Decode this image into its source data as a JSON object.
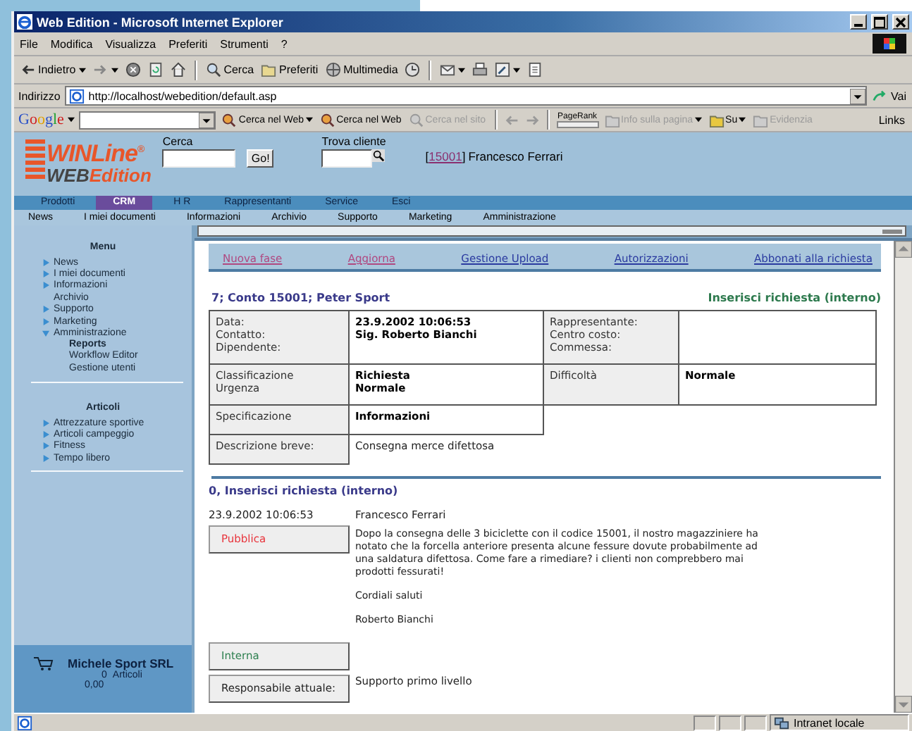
{
  "window": {
    "title": "Web Edition - Microsoft Internet Explorer"
  },
  "menu_bar": [
    "File",
    "Modifica",
    "Visualizza",
    "Preferiti",
    "Strumenti",
    "?"
  ],
  "toolbar": [
    {
      "kind": "button",
      "label": "Indietro",
      "caret": true
    },
    {
      "kind": "button",
      "caret": true
    },
    {
      "kind": "button"
    },
    {
      "kind": "button"
    },
    {
      "kind": "button"
    },
    {
      "kind": "separator"
    },
    {
      "kind": "button",
      "label": "Cerca"
    },
    {
      "kind": "button",
      "label": "Preferiti"
    },
    {
      "kind": "button",
      "label": "Multimedia"
    },
    {
      "kind": "button"
    },
    {
      "kind": "separator"
    },
    {
      "kind": "button",
      "caret": true
    },
    {
      "kind": "button"
    },
    {
      "kind": "button",
      "caret": true
    },
    {
      "kind": "button"
    }
  ],
  "address_bar": {
    "label": "Indirizzo",
    "value": "http://localhost/webedition/default.asp",
    "go": "Vai"
  },
  "google_bar": {
    "logo": "Google",
    "items": [
      {
        "label": "Cerca nel Web",
        "caret": true,
        "disabled": false
      },
      {
        "label": "Cerca nel Web",
        "caret": false,
        "disabled": false
      },
      {
        "label": "Cerca nel sito",
        "caret": false,
        "disabled": true
      }
    ],
    "pagerank": "PageRank",
    "items2": [
      {
        "label": "Info sulla pagina",
        "caret": true,
        "disabled": true
      },
      {
        "label": "Su",
        "caret": true,
        "disabled": false
      },
      {
        "label": "Evidenzia",
        "caret": false,
        "disabled": true
      }
    ],
    "links": "Links"
  },
  "header": {
    "logo_top": "WINLine",
    "logo_mark": "®",
    "logo_bottom_a": "WEB",
    "logo_bottom_b": "Edition",
    "search_label": "Cerca",
    "go": "Go!",
    "find_label": "Trova cliente",
    "customer_open": "[",
    "customer_code": "15001",
    "customer_close": "]",
    "customer_name": "Francesco Ferrari"
  },
  "nav_tabs": [
    {
      "label": "Prodotti",
      "selected": false
    },
    {
      "label": "CRM",
      "selected": true
    },
    {
      "label": "H R",
      "selected": false
    },
    {
      "label": "Rappresentanti",
      "selected": false
    },
    {
      "label": "Service",
      "selected": false
    },
    {
      "label": "Esci",
      "selected": false
    }
  ],
  "sub_nav": [
    "News",
    "I miei documenti",
    "Informazioni",
    "Archivio",
    "Supporto",
    "Marketing",
    "Amministrazione"
  ],
  "sidebar": {
    "menu_title": "Menu",
    "menu": [
      {
        "label": "News",
        "kind": "arrow",
        "expanded": false
      },
      {
        "label": "I miei documenti",
        "kind": "arrow",
        "expanded": false
      },
      {
        "label": "Informazioni",
        "kind": "arrow",
        "expanded": false
      },
      {
        "label": "Archivio",
        "kind": "plain"
      },
      {
        "label": "Supporto",
        "kind": "arrow",
        "expanded": false
      },
      {
        "label": "Marketing",
        "kind": "arrow",
        "expanded": false
      },
      {
        "label": "Amministrazione",
        "kind": "arrow",
        "expanded": true,
        "children": [
          {
            "label": "Reports",
            "selected": true
          },
          {
            "label": "Workflow Editor",
            "selected": false
          },
          {
            "label": "Gestione utenti",
            "selected": false
          }
        ]
      }
    ],
    "articles_title": "Articoli",
    "articles": [
      {
        "label": "Attrezzature sportive",
        "kind": "arrow",
        "expanded": false
      },
      {
        "label": "Articoli campeggio",
        "kind": "arrow",
        "expanded": false
      },
      {
        "label": "Fitness",
        "kind": "arrow",
        "expanded": false
      },
      {
        "label": "Tempo libero",
        "kind": "arrow",
        "expanded": false
      }
    ],
    "cart": {
      "company": "Michele Sport SRL",
      "count": "0",
      "count_label": "Articoli",
      "total": "0,00"
    }
  },
  "content": {
    "actions": [
      {
        "label": "Nuova fase",
        "visited": true
      },
      {
        "label": "Aggiorna",
        "visited": true
      },
      {
        "label": "Gestione Upload",
        "visited": false
      },
      {
        "label": "Autorizzazioni",
        "visited": false
      },
      {
        "label": "Abbonati alla richiesta",
        "visited": false
      }
    ],
    "heading": "7; Conto 15001; Peter Sport",
    "heading_right": "Inserisci richiesta (interno)",
    "details": [
      {
        "cells": [
          {
            "kind": "label",
            "lines": [
              "Data:",
              "Contatto:",
              "Dipendente:"
            ]
          },
          {
            "kind": "value",
            "lines": [
              "23.9.2002 10:06:53",
              "Sig. Roberto Bianchi"
            ]
          },
          {
            "kind": "label",
            "lines": [
              "Rappresentante:",
              "Centro costo:",
              "Commessa:"
            ]
          },
          {
            "kind": "value"
          }
        ]
      },
      {
        "cells": [
          {
            "kind": "label",
            "lines": [
              "Classificazione",
              "Urgenza"
            ]
          },
          {
            "kind": "value",
            "lines": [
              "Richiesta",
              "Normale"
            ]
          },
          {
            "kind": "label",
            "lines": [
              "Difficoltà"
            ]
          },
          {
            "kind": "value",
            "lines": [
              "Normale"
            ]
          }
        ]
      },
      {
        "cells": [
          {
            "kind": "label",
            "lines": [
              "Specificazione"
            ]
          },
          {
            "kind": "value",
            "lines": [
              "Informazioni"
            ]
          }
        ]
      },
      {
        "cells": [
          {
            "kind": "label",
            "lines": [
              "Descrizione breve:"
            ]
          },
          {
            "kind": "plain",
            "lines": [
              "Consegna merce difettosa"
            ]
          }
        ]
      }
    ],
    "entry_heading": "0, Inserisci richiesta (interno)",
    "entry": [
      {
        "kind": "meta",
        "date": "23.9.2002 10:06:53",
        "author": "Francesco Ferrari"
      },
      {
        "kind": "section",
        "label": "Pubblica",
        "color": "#e8343c",
        "paragraphs": [
          "Dopo la consegna delle 3 biciclette con il codice 15001, il nostro magazziniere ha notato che la forcella anteriore presenta alcune fessure dovute probabilmente ad una saldatura difettosa. Come fare a rimediare? i clienti non comprebbero mai prodotti fessurati!",
          "Cordiali saluti",
          "Roberto Bianchi"
        ]
      },
      {
        "kind": "section",
        "label": "Interna",
        "color": "#2e8050"
      },
      {
        "kind": "field",
        "label": "Responsabile attuale:",
        "value": "Supporto primo livello"
      }
    ]
  },
  "status_bar": {
    "zone": "Intranet locale"
  }
}
